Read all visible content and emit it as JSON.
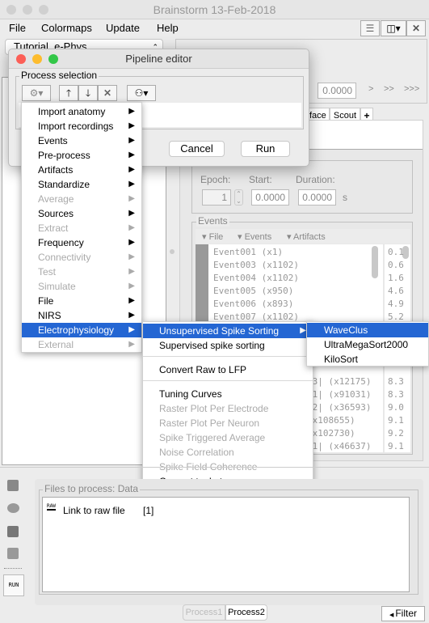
{
  "window": {
    "title": "Brainstorm 13-Feb-2018"
  },
  "menubar": {
    "items": [
      "File",
      "Colormaps",
      "Update",
      "Help"
    ]
  },
  "toolbar_icons": [
    "list-icon",
    "layout-icon",
    "close-icon"
  ],
  "protocol": {
    "selected": "Tutorial_e-Phys"
  },
  "time": {
    "value": "0.0000",
    "nav": [
      ">",
      ">>",
      ">>>"
    ]
  },
  "tabs": [
    "face",
    "Scout",
    "+"
  ],
  "epoch": {
    "epoch_label": "Epoch:",
    "start_label": "Start:",
    "duration_label": "Duration:",
    "epoch": "1",
    "start": "0.0000",
    "duration": "0.0000",
    "unit": "s"
  },
  "events": {
    "title": "Events",
    "menus": [
      "File",
      "Events",
      "Artifacts"
    ],
    "rows": [
      "Event001 (x1)",
      "Event003 (x1102)",
      "Event004 (x1102)",
      "Event005 (x950)",
      "Event006 (x893)",
      "Event007 (x1102)"
    ],
    "hidden_rows": [
      "|3| (x12175)",
      "|1| (x91031)",
      "|2| (x36593)",
      "(x108655)",
      "(x102730)",
      "|1| (x46637)"
    ],
    "times": [
      "0.1",
      "0.6",
      "1.6",
      "4.6",
      "4.9",
      "5.2"
    ],
    "hidden_times": [
      "8.3",
      "8.3",
      "9.0",
      "9.1",
      "9.2",
      "9.1"
    ]
  },
  "pipeline": {
    "title": "Pipeline editor",
    "group": "Process selection",
    "cancel": "Cancel",
    "run": "Run"
  },
  "menu": {
    "items": [
      {
        "label": "Import anatomy",
        "enabled": true
      },
      {
        "label": "Import recordings",
        "enabled": true
      },
      {
        "label": "Events",
        "enabled": true
      },
      {
        "label": "Pre-process",
        "enabled": true
      },
      {
        "label": "Artifacts",
        "enabled": true
      },
      {
        "label": "Standardize",
        "enabled": true
      },
      {
        "label": "Average",
        "enabled": false
      },
      {
        "label": "Sources",
        "enabled": true
      },
      {
        "label": "Extract",
        "enabled": false
      },
      {
        "label": "Frequency",
        "enabled": true
      },
      {
        "label": "Connectivity",
        "enabled": false
      },
      {
        "label": "Test",
        "enabled": false
      },
      {
        "label": "Simulate",
        "enabled": false
      },
      {
        "label": "File",
        "enabled": true
      },
      {
        "label": "NIRS",
        "enabled": true
      },
      {
        "label": "Electrophysiology",
        "enabled": true,
        "selected": true
      },
      {
        "label": "External",
        "enabled": false
      }
    ]
  },
  "submenu": {
    "unsupervised": "Unsupervised Spike Sorting",
    "supervised": "Supervised spike sorting",
    "convert_lfp": "Convert Raw to LFP",
    "tuning": "Tuning Curves",
    "raster_electrode": "Raster Plot Per Electrode",
    "raster_neuron": "Raster Plot Per Neuron",
    "sta": "Spike Triggered Average",
    "noise": "Noise Correlation",
    "sfc": "Spike Field Coherence",
    "convert_bst": "Convert to .bst"
  },
  "subsubmenu": {
    "items": [
      "WaveClus",
      "UltraMegaSort2000",
      "KiloSort"
    ]
  },
  "files": {
    "title": "Files to process: Data",
    "item": "Link to raw file",
    "count": "[1]",
    "raw_icon_text": "RAW"
  },
  "bottom": {
    "run": "RUN",
    "tab1": "Process1",
    "tab2": "Process2",
    "filter": "Filter"
  },
  "colors": {
    "highlight": "#2466d3"
  }
}
